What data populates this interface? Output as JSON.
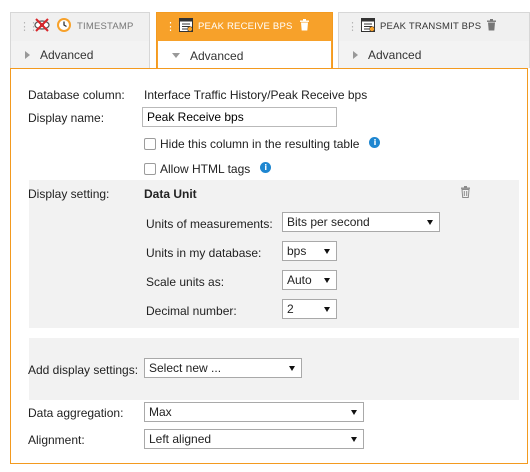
{
  "tabs": [
    {
      "title": "TIMESTAMP",
      "sub_label": "Advanced",
      "active": false,
      "icons": [
        "hidden-eye-icon",
        "clock-icon"
      ]
    },
    {
      "title": "PEAK RECEIVE BPS",
      "sub_label": "Advanced",
      "active": true,
      "icons": [
        "table-column-icon",
        "trash-icon"
      ]
    },
    {
      "title": "PEAK TRANSMIT BPS",
      "sub_label": "Advanced",
      "active": false,
      "icons": [
        "table-column-icon",
        "trash-icon"
      ]
    }
  ],
  "form": {
    "database_column_label": "Database column:",
    "database_column_value": "Interface Traffic History/Peak Receive bps",
    "display_name_label": "Display name:",
    "display_name_value": "Peak Receive bps",
    "hide_column_label": "Hide this column in the resulting table",
    "allow_html_label": "Allow HTML tags",
    "display_setting_label": "Display setting:",
    "data_unit_title": "Data Unit",
    "units_of_measurement_label": "Units of measurements:",
    "units_of_measurement_value": "Bits per second",
    "units_in_db_label": "Units in my database:",
    "units_in_db_value": "bps",
    "scale_units_label": "Scale units as:",
    "scale_units_value": "Auto",
    "decimal_label": "Decimal number:",
    "decimal_value": "2",
    "add_display_label": "Add display settings:",
    "add_display_value": "Select new ...",
    "aggregation_label": "Data aggregation:",
    "aggregation_value": "Max",
    "alignment_label": "Alignment:",
    "alignment_value": "Left aligned"
  },
  "colors": {
    "accent": "#f7a12a",
    "info": "#1e86d0",
    "gray_bg": "#f2f2f2"
  }
}
